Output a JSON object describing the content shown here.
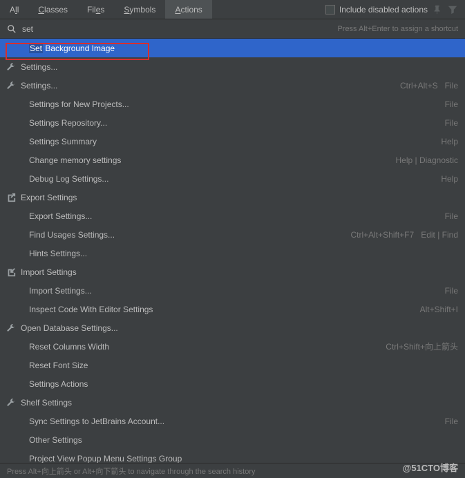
{
  "tabs": {
    "items": [
      "All",
      "Classes",
      "Files",
      "Symbols",
      "Actions"
    ],
    "active_index": 4,
    "checkbox_label": "Include disabled actions"
  },
  "search": {
    "query": "set",
    "hint": "Press Alt+Enter to assign a shortcut"
  },
  "results": [
    {
      "icon": "none",
      "indent": true,
      "label_pre": "Set",
      "label_post": " Background Image",
      "selected": true,
      "shortcut": "",
      "context": ""
    },
    {
      "icon": "wrench",
      "label": "Settings...",
      "shortcut": "",
      "context": ""
    },
    {
      "icon": "wrench",
      "label": "Settings...",
      "shortcut": "Ctrl+Alt+S",
      "context": "File"
    },
    {
      "icon": "none",
      "indent": true,
      "label": "Settings for New Projects...",
      "shortcut": "",
      "context": "File"
    },
    {
      "icon": "none",
      "indent": true,
      "label": "Settings Repository...",
      "shortcut": "",
      "context": "File"
    },
    {
      "icon": "none",
      "indent": true,
      "label": "Settings Summary",
      "shortcut": "",
      "context": "Help"
    },
    {
      "icon": "none",
      "indent": true,
      "label": "Change memory settings",
      "shortcut": "",
      "context": "Help | Diagnostic"
    },
    {
      "icon": "none",
      "indent": true,
      "label": "Debug Log Settings...",
      "shortcut": "",
      "context": "Help"
    },
    {
      "icon": "export",
      "label": "Export Settings",
      "shortcut": "",
      "context": ""
    },
    {
      "icon": "none",
      "indent": true,
      "label": "Export Settings...",
      "shortcut": "",
      "context": "File"
    },
    {
      "icon": "none",
      "indent": true,
      "label": "Find Usages Settings...",
      "shortcut": "Ctrl+Alt+Shift+F7",
      "context": "Edit | Find"
    },
    {
      "icon": "none",
      "indent": true,
      "label": "Hints Settings...",
      "shortcut": "",
      "context": ""
    },
    {
      "icon": "import",
      "label": "Import Settings",
      "shortcut": "",
      "context": ""
    },
    {
      "icon": "none",
      "indent": true,
      "label": "Import Settings...",
      "shortcut": "",
      "context": "File"
    },
    {
      "icon": "none",
      "indent": true,
      "label": "Inspect Code With Editor Settings",
      "shortcut": "Alt+Shift+I",
      "context": ""
    },
    {
      "icon": "wrench",
      "label": "Open Database Settings...",
      "shortcut": "",
      "context": ""
    },
    {
      "icon": "none",
      "indent": true,
      "label": "Reset Columns Width",
      "shortcut": "Ctrl+Shift+向上箭头",
      "context": ""
    },
    {
      "icon": "none",
      "indent": true,
      "label": "Reset Font Size",
      "shortcut": "",
      "context": ""
    },
    {
      "icon": "none",
      "indent": true,
      "label": "Settings Actions",
      "shortcut": "",
      "context": ""
    },
    {
      "icon": "wrench",
      "label": "Shelf Settings",
      "shortcut": "",
      "context": ""
    },
    {
      "icon": "none",
      "indent": true,
      "label": "Sync Settings to JetBrains Account...",
      "shortcut": "",
      "context": "File"
    },
    {
      "icon": "none",
      "indent": true,
      "label": "Other Settings",
      "shortcut": "",
      "context": ""
    },
    {
      "icon": "none",
      "indent": true,
      "label": "Project View Popup Menu Settings Group",
      "shortcut": "",
      "context": ""
    }
  ],
  "footer": {
    "text": "Press Alt+向上箭头 or Alt+向下箭头 to navigate through the search history"
  },
  "watermark": "@51CTO博客"
}
